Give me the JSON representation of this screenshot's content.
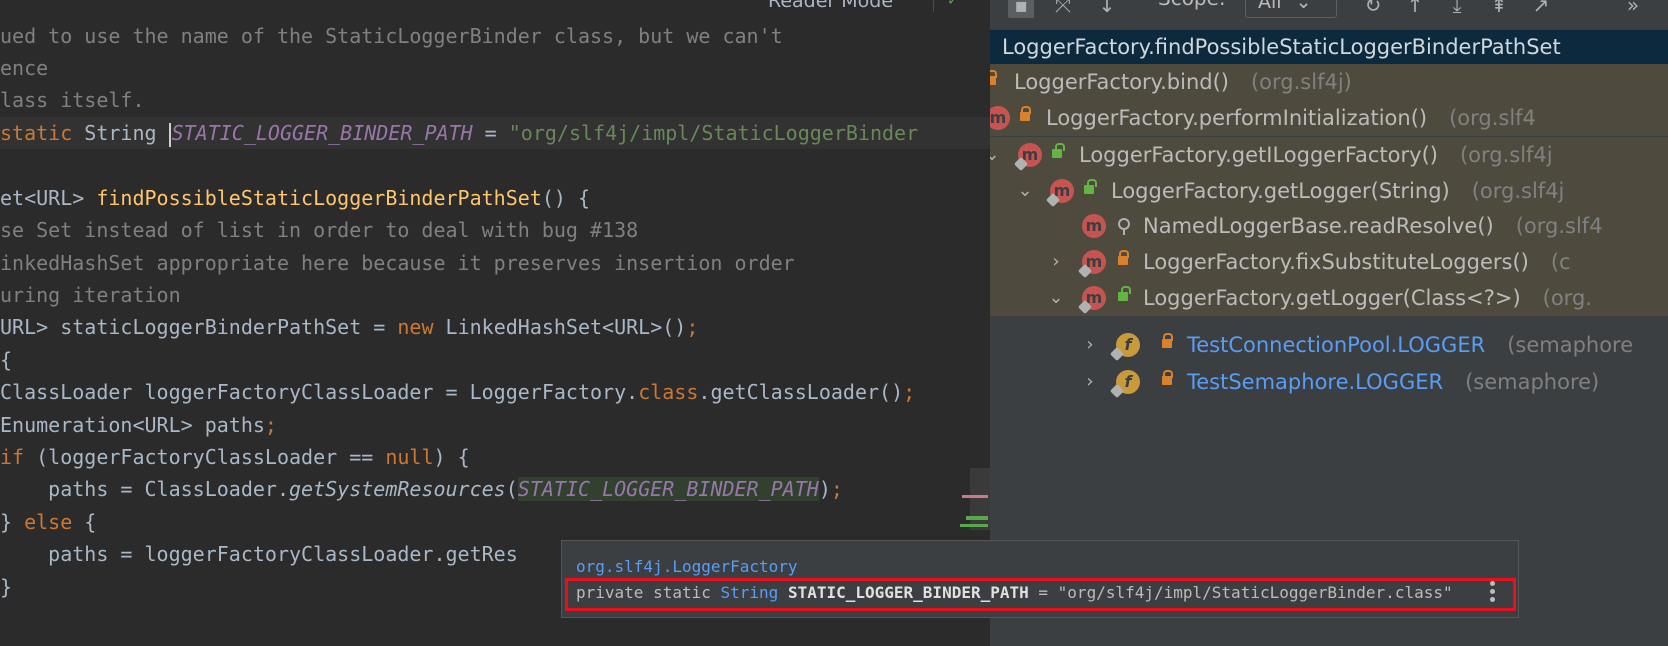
{
  "editor": {
    "reader_mode_label": "Reader Mode",
    "lines": {
      "c1": "ued to use the name of the StaticLoggerBinder class, but we can't",
      "c2": "ence",
      "c3": "lass itself.",
      "l4_kw": "static",
      "l4_type": " String ",
      "l4_field": "STATIC_LOGGER_BINDER_PATH",
      "l4_eq": " = ",
      "l4_str": "\"org/slf4j/impl/StaticLoggerBinder",
      "l6_pre": "et<URL> ",
      "l6_fn": "findPossibleStaticLoggerBinderPathSet",
      "l6_post": "() {",
      "c7": "se Set instead of list in order to deal with bug #138",
      "c8": "inkedHashSet appropriate here because it preserves insertion order",
      "c9": "uring iteration",
      "l10_pre": "URL> staticLoggerBinderPathSet = ",
      "l10_kw": "new",
      "l10_post": " LinkedHashSet<URL>()",
      "l10_semi": ";",
      "l11": "{",
      "l12_pre": "ClassLoader loggerFactoryClassLoader = LoggerFactory.",
      "l12_kw": "class",
      "l12_post": ".getClassLoader()",
      "l12_semi": ";",
      "l13_pre": "Enumeration<URL> paths",
      "l13_semi": ";",
      "l14_kw": "if",
      "l14_mid": " (loggerFactoryClassLoader == ",
      "l14_null": "null",
      "l14_post": ") {",
      "l15_pre": "    paths = ClassLoader.",
      "l15_method": "getSystemResources",
      "l15_paren": "(",
      "l15_field": "STATIC_LOGGER_BINDER_PATH",
      "l15_post": ")",
      "l15_semi": ";",
      "l16_pre": "} ",
      "l16_kw": "else",
      "l16_post": " {",
      "l17": "    paths = loggerFactoryClassLoader.getRes",
      "l18": "}"
    }
  },
  "hierarchy": {
    "scope_label": "Scope:",
    "scope_value": "All",
    "title": "LoggerFactory.findPossibleStaticLoggerBinderPathSet",
    "rows": [
      {
        "label": "LoggerFactory.bind()",
        "loc": "(org.slf4j)"
      },
      {
        "label": "LoggerFactory.performInitialization()",
        "loc": "(org.slf4"
      },
      {
        "label": "LoggerFactory.getILoggerFactory()",
        "loc": "(org.slf4j"
      },
      {
        "label": "LoggerFactory.getLogger(String)",
        "loc": "(org.slf4j"
      },
      {
        "label": "NamedLoggerBase.readResolve()",
        "loc": "(org.slf4"
      },
      {
        "label": "LoggerFactory.fixSubstituteLoggers()",
        "loc": "(c"
      },
      {
        "label": "LoggerFactory.getLogger(Class<?>)",
        "loc": "(org."
      },
      {
        "label": "TestConnectionPool.LOGGER",
        "loc": "(semaphore"
      },
      {
        "label": "TestSemaphore.LOGGER",
        "loc": "(semaphore)"
      }
    ]
  },
  "popup": {
    "class_name": "org.slf4j.LoggerFactory",
    "decl_mods": "private static ",
    "decl_type": "String",
    "decl_name": "STATIC_LOGGER_BINDER_PATH",
    "decl_value": " = \"org/slf4j/impl/StaticLoggerBinder.class\""
  },
  "colors": {
    "editor_bg": "#2b2b2b",
    "keyword": "#cc7832",
    "function": "#ffc66d",
    "string": "#6a8759",
    "static_field": "#9876aa",
    "comment": "#808080",
    "link": "#589df6",
    "highlight_box": "#e8101c"
  }
}
